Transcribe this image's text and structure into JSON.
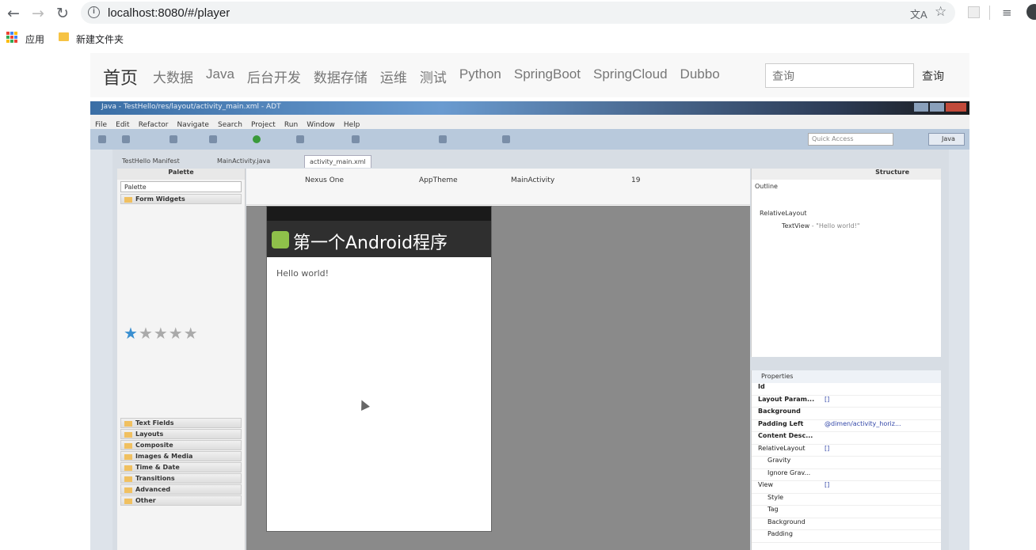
{
  "browser": {
    "url": "localhost:8080/#/player",
    "bookmarks": {
      "apps_label": "应用",
      "folder_label": "新建文件夹"
    }
  },
  "site": {
    "brand": "首页",
    "nav": [
      "大数据",
      "Java",
      "后台开发",
      "数据存储",
      "运维",
      "测试",
      "Python",
      "SpringBoot",
      "SpringCloud",
      "Dubbo"
    ],
    "search_placeholder": "查询",
    "search_button": "查询"
  },
  "video": {
    "window_title": "Java - TestHello/res/layout/activity_main.xml - ADT",
    "menu": [
      "File",
      "Edit",
      "Refactor",
      "Navigate",
      "Search",
      "Project",
      "Run",
      "Window",
      "Help"
    ],
    "quick_access": "Quick Access",
    "perspective": "Java",
    "tabs": [
      "TestHello Manifest",
      "MainActivity.java",
      "activity_main.xml"
    ],
    "palette": {
      "header": "Palette",
      "select": "Palette",
      "form_widgets": "Form Widgets",
      "groups": [
        "Text Fields",
        "Layouts",
        "Composite",
        "Images & Media",
        "Time & Date",
        "Transitions",
        "Advanced",
        "Other"
      ]
    },
    "canvas_toolbar": {
      "device": "Nexus One",
      "theme": "AppTheme",
      "activity": "MainActivity",
      "api": "19"
    },
    "app": {
      "title": "第一个Android程序",
      "text": "Hello world!"
    },
    "outline": {
      "header": "Structure",
      "tab": "Outline",
      "root": "RelativeLayout",
      "child": "TextView",
      "child_value": "- \"Hello world!\""
    },
    "properties": {
      "header": "Properties",
      "rows": [
        {
          "k": "Id",
          "v": ""
        },
        {
          "k": "Layout Param...",
          "v": "[]"
        },
        {
          "k": "Background",
          "v": ""
        },
        {
          "k": "Padding Left",
          "v": "@dimen/activity_horiz..."
        },
        {
          "k": "Content Desc...",
          "v": ""
        },
        {
          "k": "RelativeLayout",
          "v": "[]"
        },
        {
          "k": "Gravity",
          "v": ""
        },
        {
          "k": "Ignore Grav...",
          "v": ""
        },
        {
          "k": "View",
          "v": "[]"
        },
        {
          "k": "Style",
          "v": ""
        },
        {
          "k": "Tag",
          "v": ""
        },
        {
          "k": "Background",
          "v": ""
        },
        {
          "k": "Padding",
          "v": ""
        }
      ]
    }
  }
}
